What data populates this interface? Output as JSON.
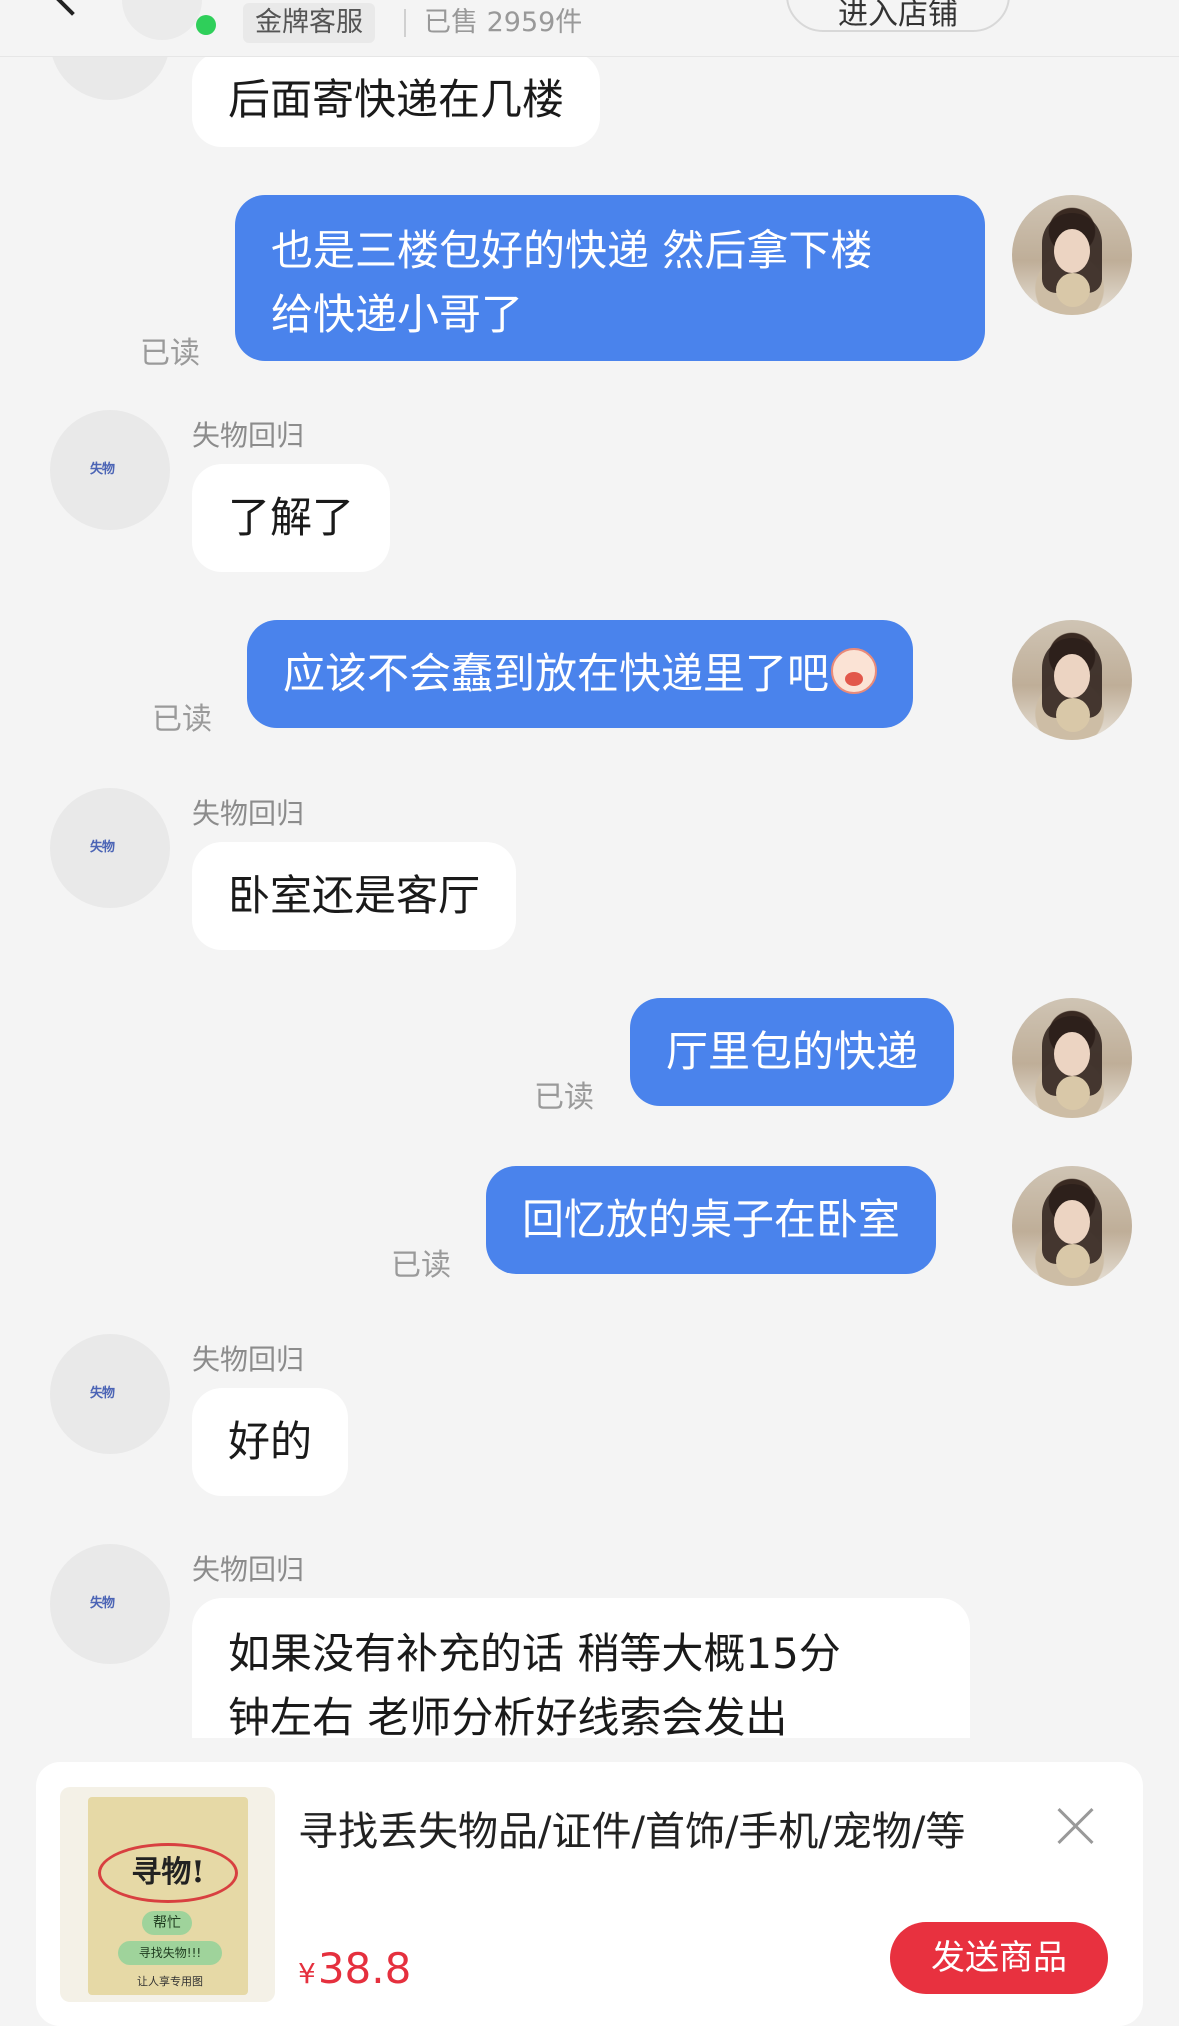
{
  "header": {
    "badge": "金牌客服",
    "sold": "已售 2959件",
    "enter_shop": "进入店铺"
  },
  "chat": {
    "shop_name": "失物回归",
    "shop_logo_text": "失物",
    "read_label": "已读",
    "messages": [
      {
        "from": "shop",
        "text": "后面寄快递在几楼"
      },
      {
        "from": "user",
        "lines": [
          "也是三楼包好的快递 然后拿下楼",
          "给快递小哥了"
        ],
        "read": true
      },
      {
        "from": "shop",
        "text": "了解了"
      },
      {
        "from": "user",
        "text": "应该不会蠢到放在快递里了吧",
        "emoji": "crying-face-emoji",
        "read": true
      },
      {
        "from": "shop",
        "text": "卧室还是客厅"
      },
      {
        "from": "user",
        "text": "厅里包的快递",
        "read": true
      },
      {
        "from": "user",
        "text": "回忆放的桌子在卧室",
        "read": true
      },
      {
        "from": "shop",
        "text": "好的"
      },
      {
        "from": "shop",
        "lines": [
          "如果没有补充的话  稍等大概15分",
          "钟左右 老师分析好线索会发出"
        ]
      }
    ]
  },
  "product": {
    "title": "寻找丢失物品/证件/首饰/手机/宠物/等",
    "currency": "¥",
    "price": "38.8",
    "send_label": "发送商品",
    "thumb": {
      "headline": "寻物!",
      "tag1": "帮忙",
      "tag2": "寻找失物!!!",
      "footer": "让人享专用图"
    }
  },
  "colors": {
    "outgoing_bubble": "#4a83ec",
    "price": "#e5303e",
    "send_button": "#e8313f",
    "online": "#2fcf5a"
  }
}
